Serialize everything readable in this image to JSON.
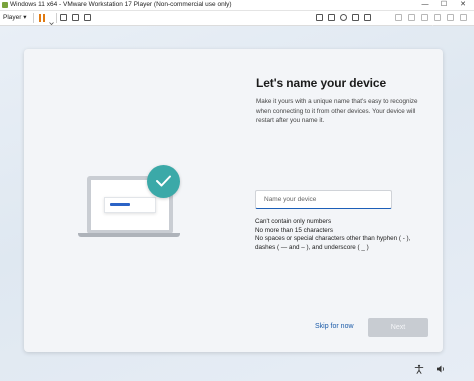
{
  "window": {
    "title": "Windows 11 x64 - VMware Workstation 17 Player (Non-commercial use only)",
    "minimize_glyph": "—",
    "maximize_glyph": "☐",
    "close_glyph": "✕"
  },
  "toolbar": {
    "player_menu": "Player ▾",
    "icons": [
      "pause-icon",
      "chevron-down-icon",
      "send-ctrl-alt-del-icon",
      "fit-guest-icon",
      "unity-icon",
      "device-icon",
      "snapshot-icon",
      "settings-icon",
      "cd-drive-icon",
      "usb-icon",
      "network-icon",
      "printer-icon",
      "sound-icon",
      "display-icon"
    ]
  },
  "oobe": {
    "heading": "Let's name your device",
    "description": "Make it yours with a unique name that's easy to recognize when connecting to it from other devices. Your device will restart after you name it.",
    "input_placeholder": "Name your device",
    "input_value": "",
    "rules": [
      "Can't contain only numbers",
      "No more than 15 characters",
      "No spaces or special characters other than hyphen ( - ),",
      "dashes ( — and – ), and underscore ( _ )"
    ],
    "skip_label": "Skip for now",
    "next_label": "Next",
    "accessibility_icon": "accessibility-icon",
    "volume_icon": "volume-icon"
  },
  "colors": {
    "accent": "#1c5fb8",
    "check": "#3ba9a8",
    "pause": "#e07a12",
    "next_disabled": "#c8ccd2"
  }
}
